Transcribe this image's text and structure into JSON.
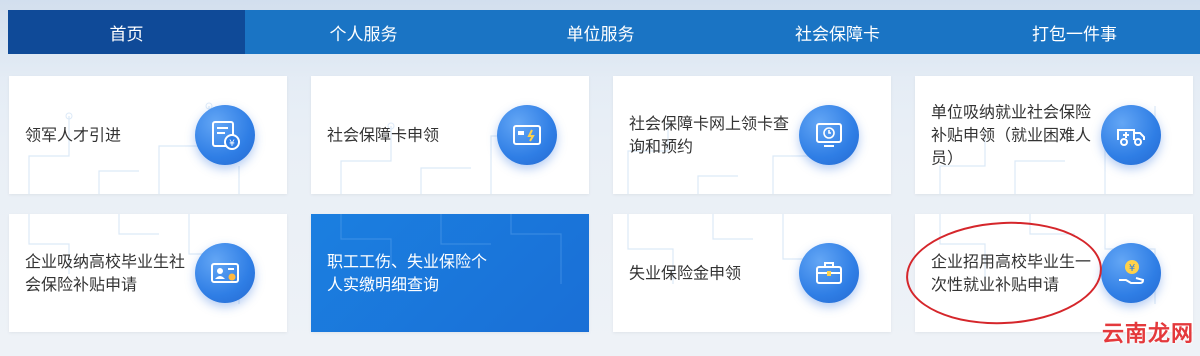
{
  "nav": {
    "items": [
      {
        "label": "首页",
        "active": true
      },
      {
        "label": "个人服务",
        "active": false
      },
      {
        "label": "单位服务",
        "active": false
      },
      {
        "label": "社会保障卡",
        "active": false
      },
      {
        "label": "打包一件事",
        "active": false
      }
    ]
  },
  "cards": [
    {
      "label": "领军人才引进",
      "icon": "certificate-yuan-icon"
    },
    {
      "label": "社会保障卡申领",
      "icon": "card-icon"
    },
    {
      "label": "社会保障卡网上领卡查询和预约",
      "icon": "monitor-clock-icon"
    },
    {
      "label": "单位吸纳就业社会保险补贴申领（就业困难人员）",
      "icon": "ambulance-icon"
    },
    {
      "label": "企业吸纳高校毕业生社会保险补贴申请",
      "icon": "id-card-icon"
    },
    {
      "label": "职工工伤、失业保险个人实缴明细查询",
      "icon": ""
    },
    {
      "label": "失业保险金申领",
      "icon": "briefcase-icon"
    },
    {
      "label": "企业招用高校毕业生一次性就业补贴申请",
      "icon": "hand-coin-icon"
    }
  ],
  "watermark": "云南龙网",
  "colors": {
    "nav_bg": "#1a74c4",
    "nav_active": "#0f4a98",
    "card_highlight": "#1a6fd6",
    "ring": "#d5262b"
  }
}
